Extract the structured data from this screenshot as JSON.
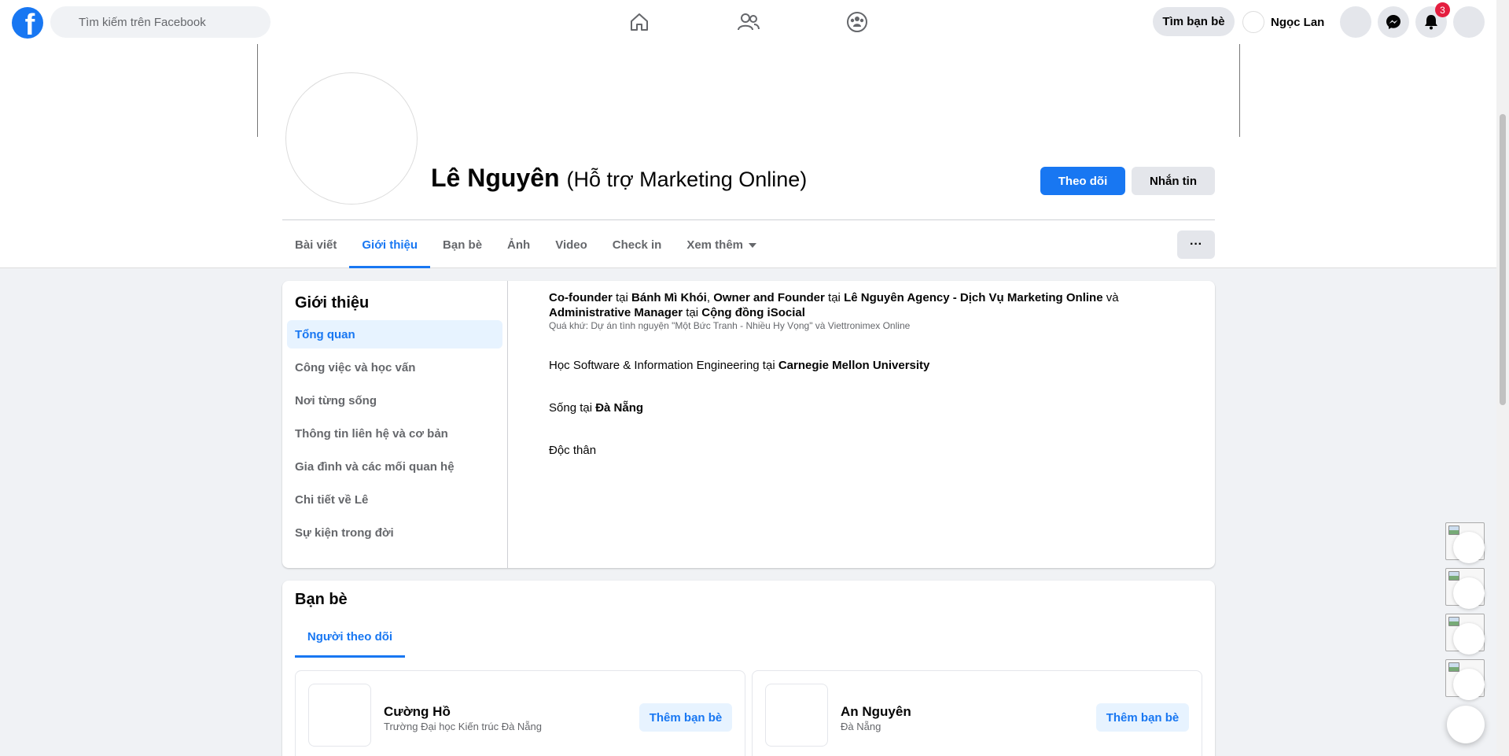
{
  "search": {
    "placeholder": "Tìm kiếm trên Facebook"
  },
  "nav": {
    "find_friends": "Tìm bạn bè",
    "user_name": "Ngọc Lan",
    "notification_count": "3"
  },
  "profile": {
    "name": "Lê Nguyên",
    "subtitle": "(Hỗ trợ Marketing Online)",
    "follow_label": "Theo dõi",
    "message_label": "Nhắn tin",
    "more_label": "···"
  },
  "tabs": [
    "Bài viết",
    "Giới thiệu",
    "Bạn bè",
    "Ảnh",
    "Video",
    "Check in",
    "Xem thêm"
  ],
  "about": {
    "title": "Giới thiệu",
    "nav": [
      "Tổng quan",
      "Công việc và học vấn",
      "Nơi từng sống",
      "Thông tin liên hệ và cơ bản",
      "Gia đình và các mối quan hệ",
      "Chi tiết về Lê",
      "Sự kiện trong đời"
    ],
    "work": {
      "role1": "Co-founder",
      "at1": " tại ",
      "org1": "Bánh Mì Khói",
      "sep1": ", ",
      "role2": "Owner and Founder",
      "at2": " tại ",
      "org2": "Lê Nguyên Agency - Dịch Vụ Marketing Online",
      "and": " và ",
      "role3": "Administrative Manager",
      "at3": " tại ",
      "org3": "Cộng đồng iSocial",
      "past": "Quá khứ: Dự án tình nguyện \"Một Bức Tranh - Nhiều Hy Vọng\" và Viettronimex Online"
    },
    "education": {
      "prefix": "Học Software & Information Engineering tại ",
      "school": "Carnegie Mellon University"
    },
    "lives": {
      "prefix": "Sống tại ",
      "city": "Đà Nẵng"
    },
    "relationship": "Độc thân"
  },
  "friends": {
    "title": "Bạn bè",
    "tab": "Người theo dõi",
    "items": [
      {
        "name": "Cường Hồ",
        "detail": "Trường Đại học Kiến trúc Đà Nẵng",
        "button": "Thêm bạn bè"
      },
      {
        "name": "An Nguyên",
        "detail": "Đà Nẵng",
        "button": "Thêm bạn bè"
      }
    ]
  },
  "colors": {
    "accent": "#1877f2",
    "background": "#f0f2f5",
    "badge": "#e41e3f"
  },
  "icons": [
    "facebook-logo-icon",
    "search-icon",
    "home-icon",
    "friends-icon",
    "groups-icon",
    "menu-icon",
    "messenger-icon",
    "bell-icon",
    "account-icon",
    "caret-down-icon"
  ]
}
